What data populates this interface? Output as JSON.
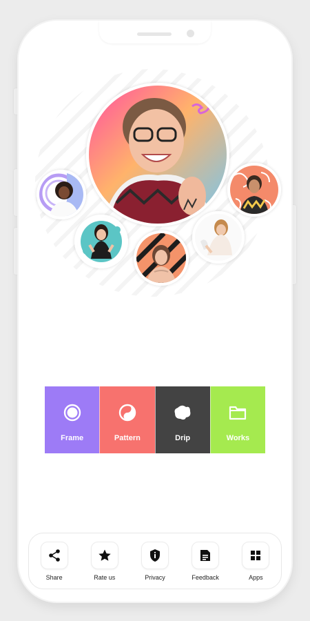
{
  "tiles": [
    {
      "label": "Frame",
      "color": "#9d7bf6",
      "icon": "frame-icon"
    },
    {
      "label": "Pattern",
      "color": "#f7726e",
      "icon": "pattern-icon"
    },
    {
      "label": "Drip",
      "color": "#434343",
      "icon": "drip-icon"
    },
    {
      "label": "Works",
      "color": "#a5ea4f",
      "icon": "folder-icon"
    }
  ],
  "bottom_nav": [
    {
      "label": "Share",
      "icon": "share-icon"
    },
    {
      "label": "Rate us",
      "icon": "star-icon"
    },
    {
      "label": "Privacy",
      "icon": "shield-icon"
    },
    {
      "label": "Feedback",
      "icon": "document-icon"
    },
    {
      "label": "Apps",
      "icon": "grid-icon"
    }
  ],
  "collage": {
    "photos": [
      {
        "name": "main-photo",
        "background": "gradient pink-orange-blue"
      },
      {
        "name": "left-photo",
        "background": "purple rings"
      },
      {
        "name": "teal-photo",
        "background": "teal splash"
      },
      {
        "name": "pattern-photo",
        "background": "black stripes on orange"
      },
      {
        "name": "drip-photo",
        "background": "white"
      },
      {
        "name": "right-photo",
        "background": "orange pattern"
      }
    ]
  }
}
